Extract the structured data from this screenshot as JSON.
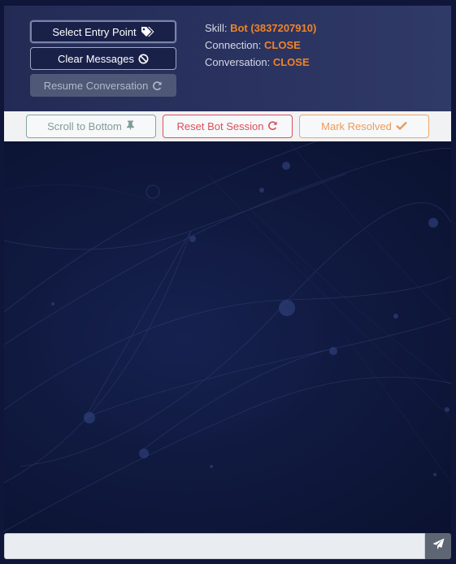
{
  "header": {
    "buttons": {
      "select_entry_point": "Select Entry Point",
      "clear_messages": "Clear Messages",
      "resume_conversation": "Resume Conversation"
    },
    "info": {
      "skill_label": "Skill:",
      "skill_value": "Bot (3837207910)",
      "connection_label": "Connection:",
      "connection_value": "CLOSE",
      "conversation_label": "Conversation:",
      "conversation_value": "CLOSE"
    }
  },
  "toolbar": {
    "scroll_label": "Scroll to Bottom",
    "reset_label": "Reset Bot Session",
    "resolve_label": "Mark Resolved"
  },
  "composer": {
    "value": "",
    "placeholder": ""
  },
  "icons": {
    "select_entry_point": "tags-icon",
    "clear_messages": "ban-icon",
    "resume_conversation": "refresh-icon",
    "scroll": "thumbtack-icon",
    "reset": "refresh-icon",
    "resolve": "check-icon",
    "send": "paper-plane-icon"
  },
  "colors": {
    "accent_orange": "#f08326",
    "reset_red": "#d9505c",
    "resolve_orange": "#eb9b5c",
    "scroll_teal": "#7e9d98"
  }
}
